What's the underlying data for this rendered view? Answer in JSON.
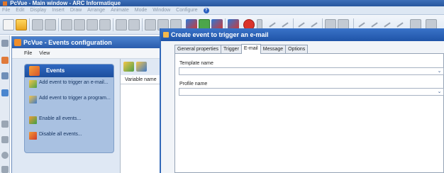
{
  "main_window": {
    "title": "PcVue - Main window - ARC Informatique",
    "menu": [
      "File",
      "Edit",
      "Display",
      "Insert",
      "Draw",
      "Arrange",
      "Animate",
      "Mode",
      "Window",
      "Configure"
    ]
  },
  "events_window": {
    "title": "PcVue - Events configuration",
    "menu": [
      "File",
      "View"
    ]
  },
  "task_panel": {
    "header": "Events",
    "items": [
      {
        "label": "Add event to trigger an e-mail...",
        "icon": "mail-event-icon"
      },
      {
        "label": "Add event to trigger a program...",
        "icon": "program-event-icon"
      },
      {
        "label": "Enable all events...",
        "icon": "enable-events-icon"
      },
      {
        "label": "Disable all events...",
        "icon": "disable-events-icon"
      }
    ]
  },
  "list": {
    "column": "Variable name"
  },
  "dialog": {
    "title": "Create event to trigger an e-mail",
    "tabs": [
      "General properties",
      "Trigger",
      "E-mail",
      "Message",
      "Options"
    ],
    "active_tab": "E-mail",
    "fields": [
      {
        "label": "Template name",
        "value": ""
      },
      {
        "label": "Profile name",
        "value": ""
      }
    ]
  },
  "colors": {
    "title_bar": "#2a5cac",
    "task_panel": "#a9c1e1",
    "task_header": "#1d4f9e"
  }
}
